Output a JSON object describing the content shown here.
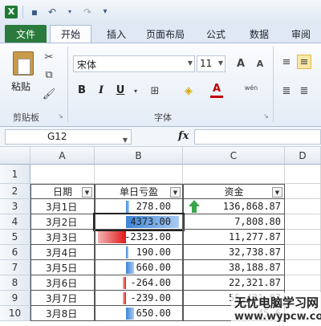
{
  "tabs": {
    "file": "文件",
    "home": "开始",
    "insert": "插入",
    "layout": "页面布局",
    "formulas": "公式",
    "data": "数据",
    "review": "审阅"
  },
  "ribbon": {
    "paste": "粘贴",
    "font_name": "宋体",
    "font_size": "11",
    "bold": "B",
    "italic": "I",
    "underline": "U",
    "font_color": "A",
    "phonetic": "wén",
    "group_clipboard": "剪贴板",
    "group_font": "字体",
    "grow_font": "A",
    "shrink_font": "A"
  },
  "formula_bar": {
    "name_box": "G12",
    "fx": "fx"
  },
  "columns": [
    "A",
    "B",
    "C",
    "D"
  ],
  "rows": [
    "1",
    "2",
    "3",
    "4",
    "5",
    "6",
    "7",
    "8",
    "9",
    "10"
  ],
  "table": {
    "headers": [
      "日期",
      "单日亏盈",
      "资金"
    ],
    "rows": [
      {
        "date": "3月1日",
        "pl": "278.00",
        "funds": "136,868.87"
      },
      {
        "date": "3月2日",
        "pl": "4373.00",
        "funds": "7,808.80"
      },
      {
        "date": "3月3日",
        "pl": "-2323.00",
        "funds": "11,277.87"
      },
      {
        "date": "3月4日",
        "pl": "190.00",
        "funds": "32,738.87"
      },
      {
        "date": "3月5日",
        "pl": "660.00",
        "funds": "38,188.87"
      },
      {
        "date": "3月6日",
        "pl": "-264.00",
        "funds": "22,321.87"
      },
      {
        "date": "3月7日",
        "pl": "-239.00",
        "funds": "55,421.87"
      },
      {
        "date": "3月8日",
        "pl": "650.00",
        "funds": "45,6"
      }
    ]
  },
  "watermark": {
    "main": "无忧电脑学习网",
    "sub": "www.wypcw.com"
  },
  "colors": {
    "positive_bar": "#3d84d8",
    "negative_bar": "#e01919",
    "trend_arrow": "#3aa64a"
  }
}
